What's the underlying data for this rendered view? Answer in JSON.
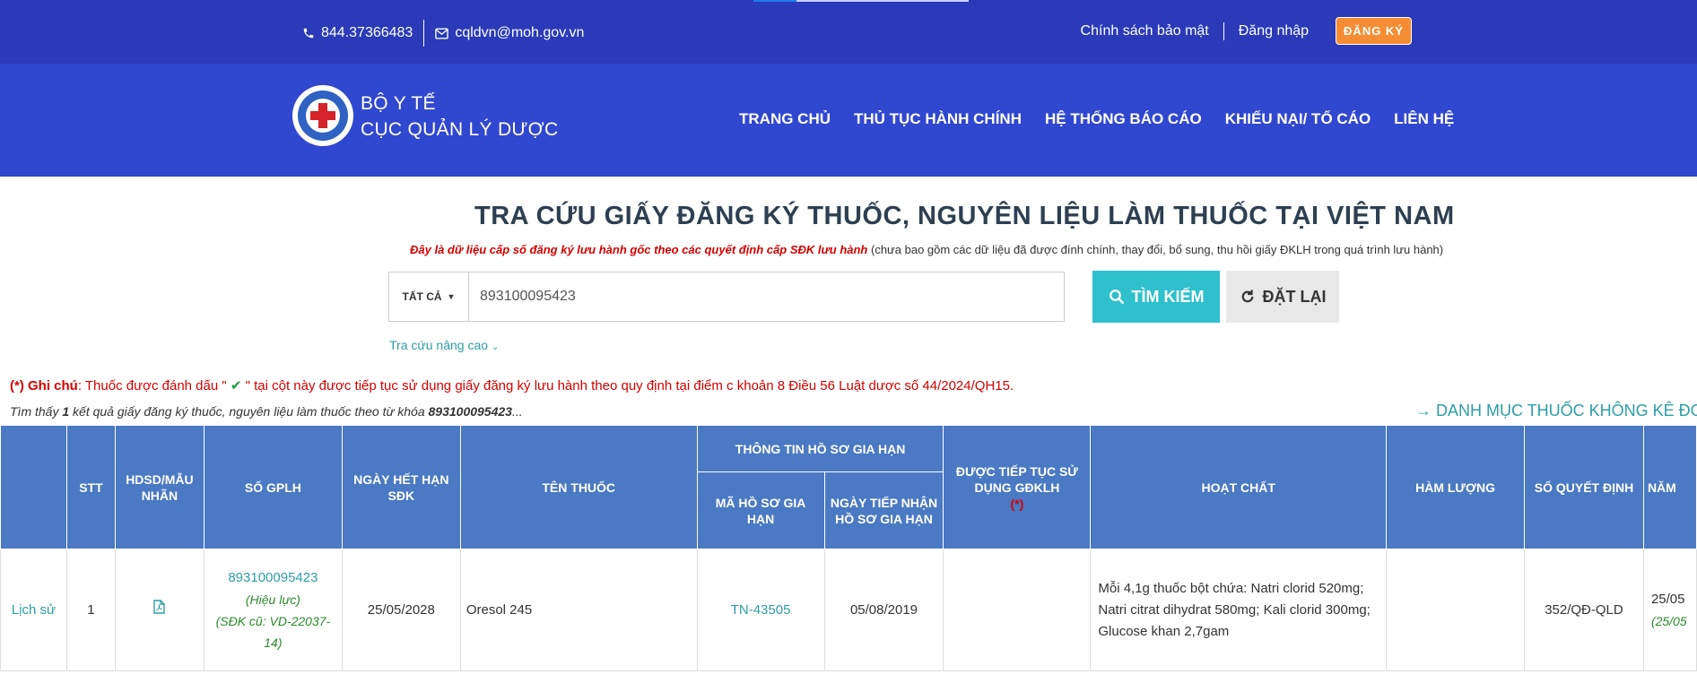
{
  "topbar": {
    "phone": "844.37366483",
    "email": "cqldvn@moh.gov.vn",
    "privacy": "Chính sách bảo mật",
    "login": "Đăng nhập",
    "register": "ĐĂNG KÝ"
  },
  "header": {
    "brand_line1": "BỘ Y TẾ",
    "brand_line2": "CỤC QUẢN LÝ DƯỢC",
    "nav": [
      "TRANG CHỦ",
      "THỦ TỤC HÀNH CHÍNH",
      "HỆ THỐNG BÁO CÁO",
      "KHIẾU NẠI/ TỐ CÁO",
      "LIÊN HỆ"
    ]
  },
  "page": {
    "title": "TRA CỨU GIẤY ĐĂNG KÝ THUỐC, NGUYÊN LIỆU LÀM THUỐC TẠI VIỆT NAM",
    "note_bold": "Đây là dữ liệu cấp số đăng ký lưu hành gốc theo các quyết định cấp SĐK lưu hành",
    "note_rest": "(chưa bao gồm các dữ liệu đã được đính chính, thay đổi, bổ sung, thu hồi giấy ĐKLH trong quá trình lưu hành)"
  },
  "search": {
    "filter": "TẤT CẢ",
    "value": "893100095423",
    "search_btn": "TÌM KIẾM",
    "reset_btn": "ĐẶT LẠI",
    "advanced": "Tra cứu nâng cao"
  },
  "notes": {
    "label": "(*) Ghi chú",
    "text_before": ": Thuốc được đánh dấu \" ",
    "text_after": " \" tại cột này được tiếp tục sử dụng giấy đăng ký lưu hành theo quy định tại điểm c khoản 8 Điều 56 Luật dược số 44/2024/QH15.",
    "found_pre": "Tìm thấy ",
    "found_count": "1",
    "found_mid": " kết quả giấy đăng ký thuốc, nguyên liệu làm thuốc theo từ khóa ",
    "found_keyword": "893100095423",
    "found_post": "...",
    "catalog_link": "→ DANH MỤC THUỐC KHÔNG KÊ ĐƠN"
  },
  "table": {
    "headers": {
      "stt": "STT",
      "hdsd": "HDSD/MẪU NHÃN",
      "so_gplh": "SỐ GPLH",
      "ngay_het_han": "NGÀY HẾT HẠN SĐK",
      "ten_thuoc": "TÊN THUỐC",
      "thong_tin_ho_so": "THÔNG TIN HỒ SƠ GIA HẠN",
      "ma_ho_so": "MÃ HỒ SƠ GIA HẠN",
      "ngay_tiep_nhan": "NGÀY TIẾP NHẬN HỒ SƠ GIA HẠN",
      "duoc_tiep_tuc": "ĐƯỢC TIẾP TỤC SỬ DỤNG GĐKLH",
      "duoc_tiep_tuc_star": "(*)",
      "hoat_chat": "HOẠT CHẤT",
      "ham_luong": "HÀM LƯỢNG",
      "so_quyet_dinh": "SỐ QUYẾT ĐỊNH",
      "nam": "NĂM"
    },
    "rows": [
      {
        "history": "Lịch sử",
        "stt": "1",
        "so_gplh": "893100095423",
        "status": "(Hiệu lực)",
        "old_sdk": "(SĐK cũ: VD-22037-14)",
        "ngay_het_han": "25/05/2028",
        "ten_thuoc": "Oresol 245",
        "ma_ho_so": "TN-43505",
        "ngay_tiep_nhan": "05/08/2019",
        "duoc_tiep_tuc": "",
        "hoat_chat": "Mỗi 4,1g thuốc bột chứa: Natri clorid 520mg; Natri citrat dihydrat 580mg; Kali clorid 300mg; Glucose khan 2,7gam",
        "ham_luong": "",
        "so_quyet_dinh": "352/QĐ-QLD",
        "nam_1": "25/05",
        "nam_2": "(25/05"
      }
    ]
  },
  "colors": {
    "topbar": "#2a3ab8",
    "header": "#3047d0",
    "accent": "#2ec0cc",
    "table_header": "#4b79c3",
    "register": "#f58d34"
  }
}
